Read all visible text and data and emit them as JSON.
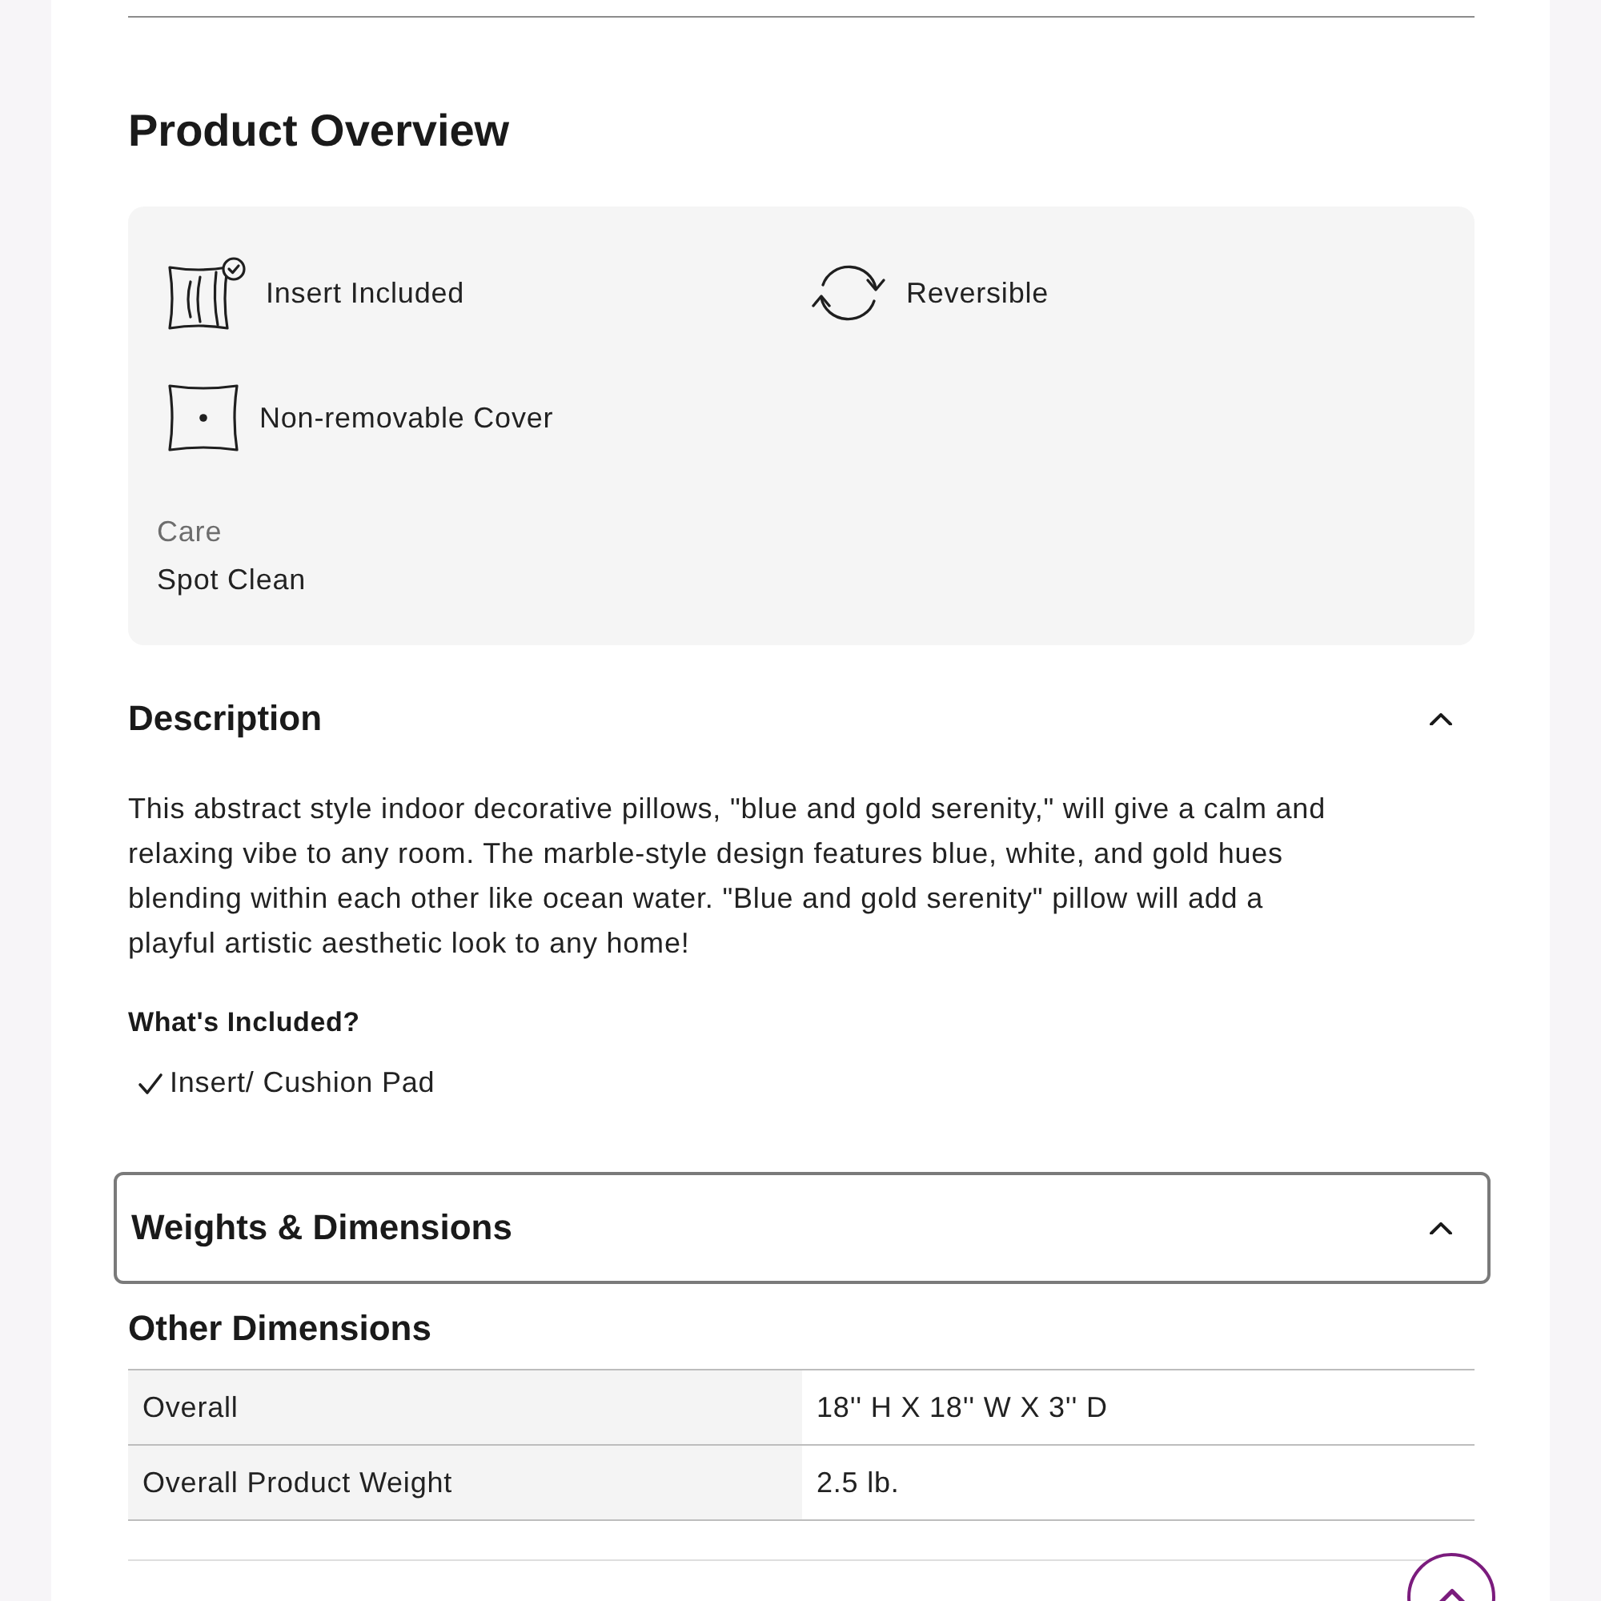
{
  "overview": {
    "title": "Product Overview",
    "features": [
      {
        "kind": "insert",
        "label": "Insert Included"
      },
      {
        "kind": "reversible",
        "label": "Reversible"
      },
      {
        "kind": "cover",
        "label": "Non-removable Cover"
      }
    ],
    "care": {
      "label": "Care",
      "value": "Spot Clean"
    }
  },
  "description": {
    "title": "Description",
    "expanded": true,
    "focused": false,
    "text": "This abstract style indoor decorative pillows, \"blue and gold serenity,\" will give a calm and relaxing vibe to any room. The marble-style design features blue, white, and gold hues blending within each other like ocean water. \"Blue and gold serenity\" pillow will add a playful artistic aesthetic look to any home!",
    "included_title": "What's Included?",
    "included": [
      "Insert/ Cushion Pad"
    ]
  },
  "dimensions": {
    "title": "Weights & Dimensions",
    "expanded": true,
    "focused": true,
    "subtitle": "Other Dimensions",
    "rows": [
      {
        "label": "Overall",
        "value": "18'' H X 18'' W X 3'' D"
      },
      {
        "label": "Overall Product Weight",
        "value": "2.5 lb."
      }
    ]
  }
}
